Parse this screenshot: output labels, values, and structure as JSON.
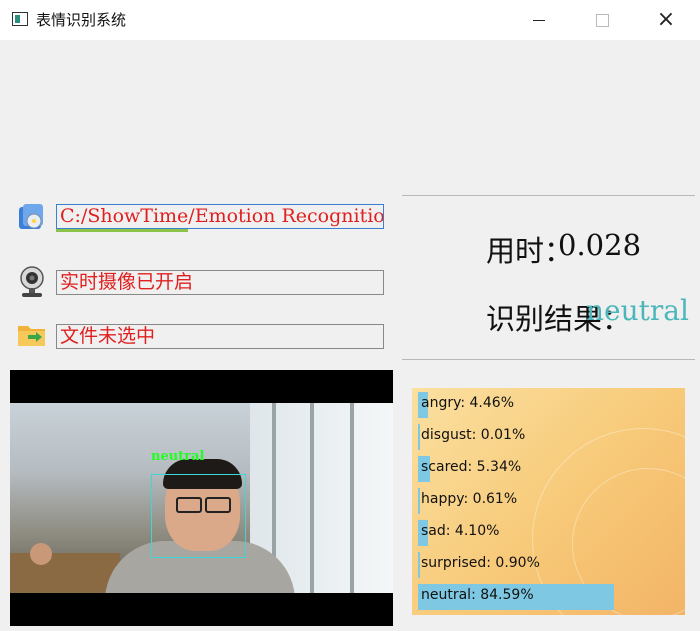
{
  "window": {
    "title": "表情识别系统",
    "minimize_label": "",
    "maximize_label": "",
    "close_label": "×"
  },
  "left_panel": {
    "path_field": {
      "value": "C:/ShowTime/Emotion Recognition"
    },
    "camera_field": {
      "value": "实时摄像已开启"
    },
    "file_field": {
      "value": "文件未选中"
    },
    "video": {
      "face_label": "neutral",
      "face_box_color": "#3fd6d6",
      "face_label_color": "#20ff20"
    }
  },
  "right_panel": {
    "time_label": "用时：",
    "time_value": "0.028",
    "result_label": "识别结果：",
    "result_value": "neutral"
  },
  "emotion_chart": {
    "type": "bar",
    "bar_color": "#7ec8e3",
    "items": [
      {
        "label": "angry",
        "value": 4.46,
        "text": "angry: 4.46%"
      },
      {
        "label": "disgust",
        "value": 0.01,
        "text": "disgust: 0.01%"
      },
      {
        "label": "scared",
        "value": 5.34,
        "text": "scared: 5.34%"
      },
      {
        "label": "happy",
        "value": 0.61,
        "text": "happy: 0.61%"
      },
      {
        "label": "sad",
        "value": 4.1,
        "text": "sad: 4.10%"
      },
      {
        "label": "surprised",
        "value": 0.9,
        "text": "surprised: 0.90%"
      },
      {
        "label": "neutral",
        "value": 84.59,
        "text": "neutral: 84.59%"
      }
    ]
  }
}
